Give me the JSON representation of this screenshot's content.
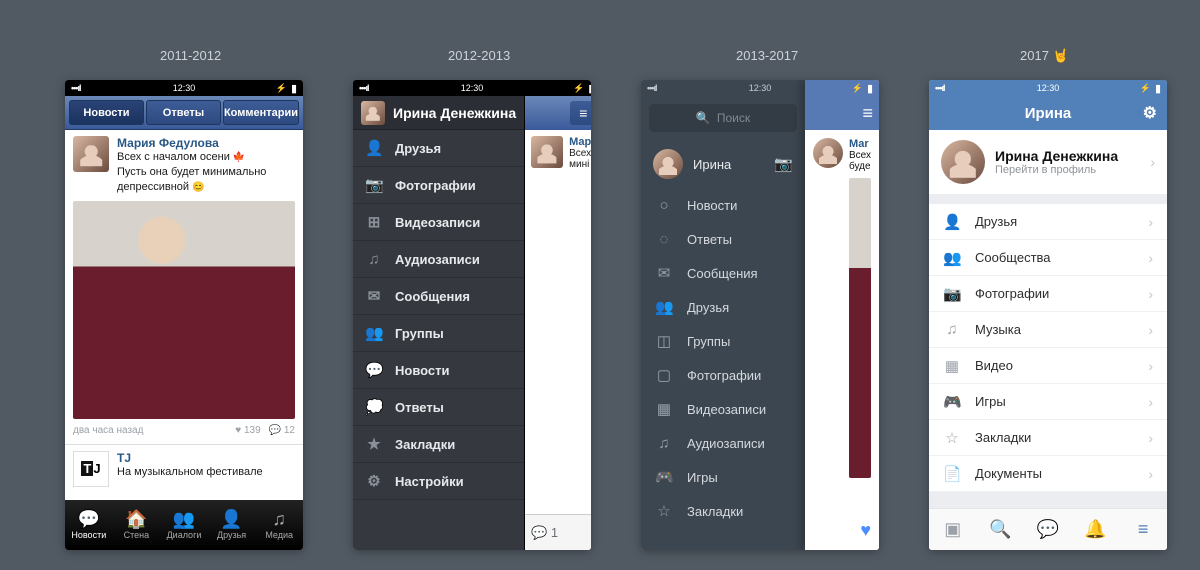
{
  "time": "12:30",
  "labels": {
    "y1": "2011-2012",
    "y2": "2012-2013",
    "y3": "2013-2017",
    "y4": "2017 🤘"
  },
  "p1": {
    "segs": {
      "news": "Новости",
      "replies": "Ответы",
      "comments": "Комментарии"
    },
    "post": {
      "author": "Мария Федулова",
      "line1": "Всех с началом осени",
      "line2": "Пусть она будет минимально",
      "line3": "депрессивной",
      "time": "два часа назад",
      "likes": "139",
      "comments": "12"
    },
    "post2": {
      "author": "TJ",
      "text": "На музыкальном фестивале"
    },
    "bb": {
      "news": "Новости",
      "wall": "Стена",
      "dialogs": "Диалоги",
      "friends": "Друзья",
      "media": "Медиа"
    }
  },
  "p2": {
    "name": "Ирина Денежкина",
    "items": [
      "Друзья",
      "Фотографии",
      "Видеозаписи",
      "Аудиозаписи",
      "Сообщения",
      "Группы",
      "Новости",
      "Ответы",
      "Закладки",
      "Настройки"
    ],
    "sliver": {
      "author": "Марі",
      "line1": "Всех",
      "line2": "мині"
    }
  },
  "p3": {
    "search": "Поиск",
    "me": "Ирина",
    "items": [
      "Новости",
      "Ответы",
      "Сообщения",
      "Друзья",
      "Группы",
      "Фотографии",
      "Видеозаписи",
      "Аудиозаписи",
      "Игры",
      "Закладки"
    ],
    "sliver": {
      "author": "Маr",
      "line1": "Всех",
      "line2": "буде"
    }
  },
  "p4": {
    "title": "Ирина",
    "profile": {
      "name": "Ирина Денежкина",
      "sub": "Перейти в профиль"
    },
    "items": [
      "Друзья",
      "Сообщества",
      "Фотографии",
      "Музыка",
      "Видео",
      "Игры",
      "Закладки",
      "Документы"
    ]
  }
}
